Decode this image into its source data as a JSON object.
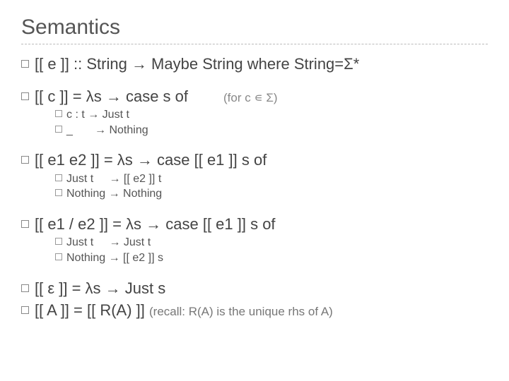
{
  "title": "Semantics",
  "l1_main": "[[ e ]] :: String → Maybe String   where String=Σ*",
  "l2_main": "[[ c ]] = λs → case s of",
  "l2_aside": "(for c ∊ Σ)",
  "l2_sub1": "c : t → Just t",
  "l2_sub2": "_       → Nothing",
  "l3_main": "[[ e1 e2 ]] = λs → case  [[ e1 ]] s   of",
  "l3_sub1": "Just t     → [[ e2 ]] t",
  "l3_sub2": "Nothing → Nothing",
  "l4_main": "[[ e1 / e2 ]] = λs → case   [[ e1 ]] s   of",
  "l4_sub1": "Just t     → Just t",
  "l4_sub2": "Nothing → [[ e2 ]] s",
  "l5_main": "[[ ε ]] = λs → Just s",
  "l6_main": "[[ A ]] = [[ R(A) ]]",
  "l6_aside": "(recall: R(A) is the unique rhs of A)"
}
